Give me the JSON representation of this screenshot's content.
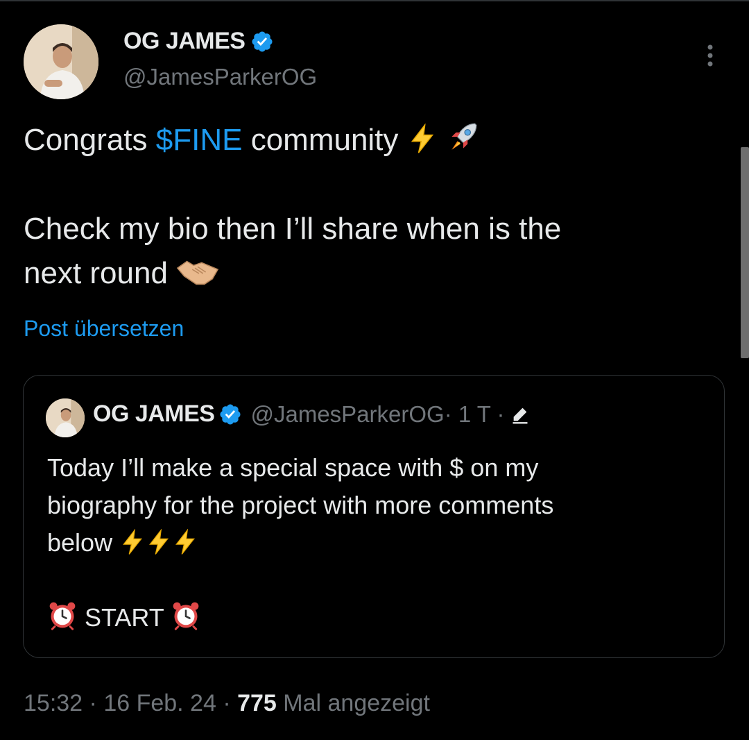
{
  "post": {
    "author_name": "OG JAMES",
    "author_handle": "@JamesParkerOG",
    "text_part1": "Congrats ",
    "cashtag": "$FINE",
    "text_part2": " community ",
    "line2": "Check my bio then I’ll share when is the",
    "line3": "next round ",
    "translate_link": "Post übersetzen"
  },
  "quoted_post": {
    "author_name": "OG JAMES",
    "author_handle": "@JamesParkerOG",
    "meta": " · 1 T · ",
    "line1": "Today I’ll make a special space with $ on my",
    "line2": "biography for the project with more comments",
    "line3": "below ",
    "start_label": "START"
  },
  "footer": {
    "time": "15:32",
    "sep1": " · ",
    "date": "16 Feb. 24",
    "sep2": " · ",
    "views": "775",
    "views_label": " Mal angezeigt"
  },
  "colors": {
    "background": "#000000",
    "text": "#e7e9ea",
    "secondary": "#71767b",
    "accent": "#1d9bf0",
    "border": "#2f3336"
  },
  "icons": [
    "verified-badge-icon",
    "more-options-icon",
    "lightning-emoji",
    "rocket-emoji",
    "handshake-emoji",
    "alarm-clock-emoji",
    "edit-pencil-icon"
  ]
}
